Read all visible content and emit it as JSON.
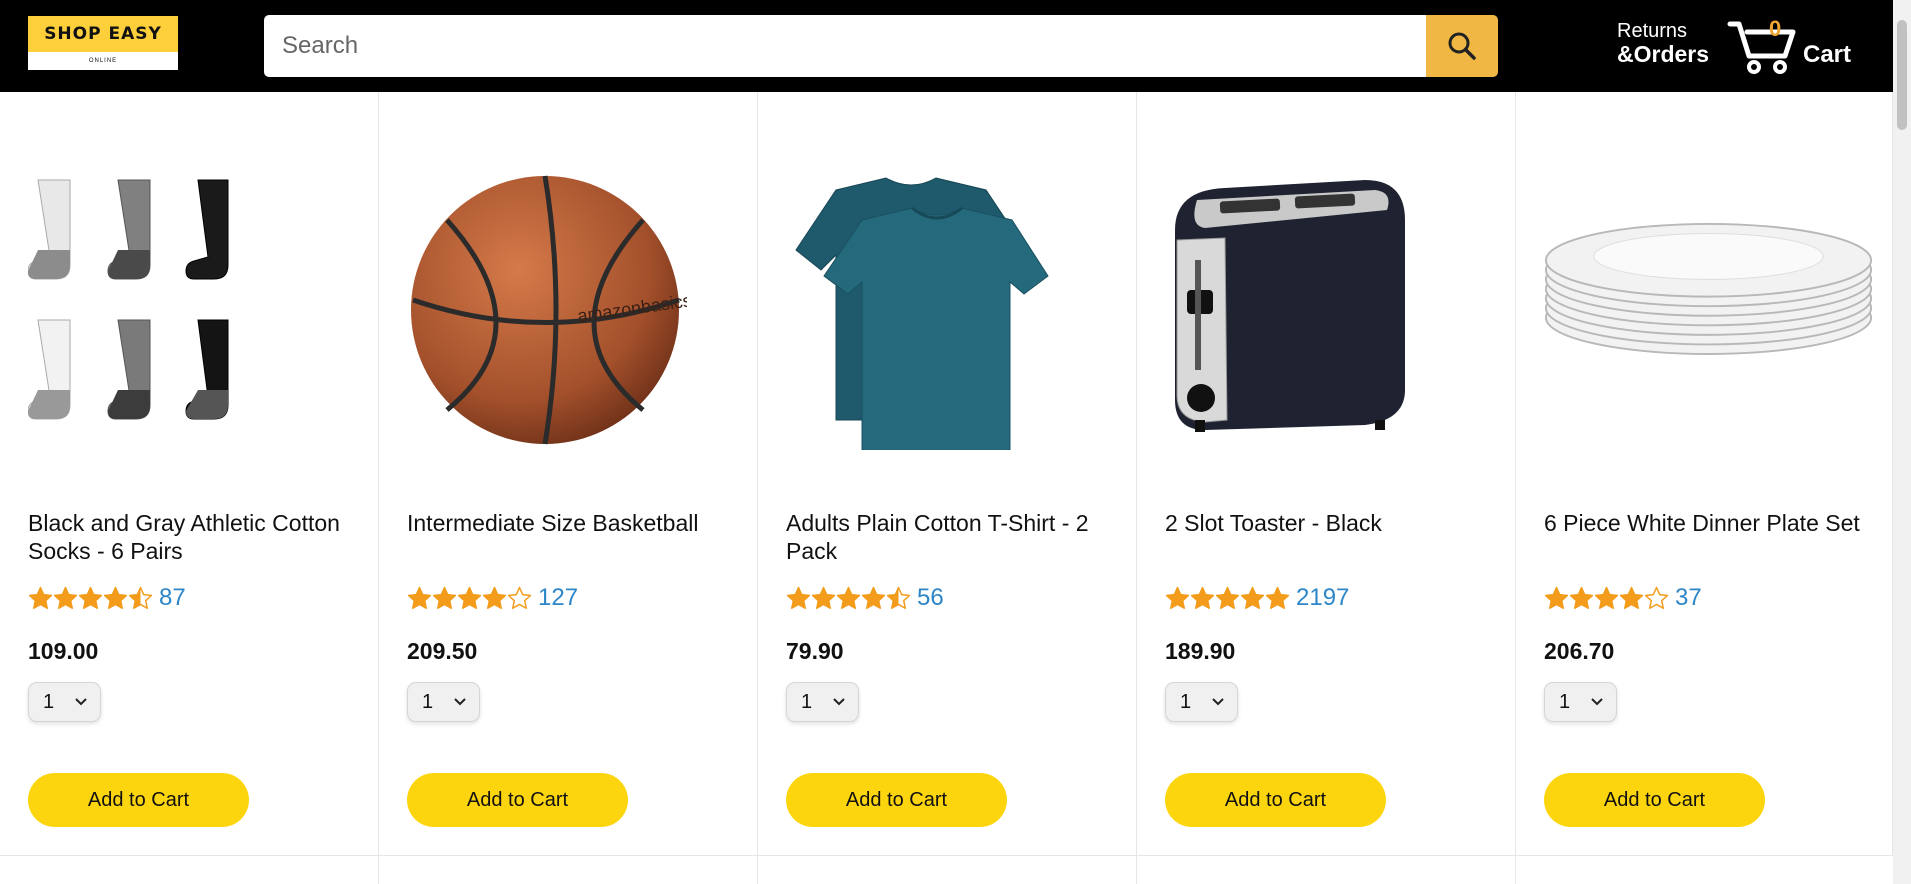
{
  "header": {
    "logo": {
      "title": "SHOP EASY",
      "subtitle": "ONLINE"
    },
    "search": {
      "placeholder": "Search"
    },
    "returns": {
      "line1": "Returns",
      "line2": "&Orders"
    },
    "cart": {
      "count": "0",
      "label": "Cart"
    },
    "colors": {
      "background": "#000000",
      "search_button": "#f0b744",
      "cart_count": "#f0a530"
    }
  },
  "products": [
    {
      "name": "Black and Gray Athletic Cotton Socks - 6 Pairs",
      "rating": 4.5,
      "rating_count": "87",
      "price": "109.00",
      "quantity": "1",
      "button": "Add to Cart",
      "image": "socks"
    },
    {
      "name": "Intermediate Size Basketball",
      "rating": 4.0,
      "rating_count": "127",
      "price": "209.50",
      "quantity": "1",
      "button": "Add to Cart",
      "image": "basketball"
    },
    {
      "name": "Adults Plain Cotton T-Shirt - 2 Pack",
      "rating": 4.5,
      "rating_count": "56",
      "price": "79.90",
      "quantity": "1",
      "button": "Add to Cart",
      "image": "tshirt"
    },
    {
      "name": "2 Slot Toaster - Black",
      "rating": 5.0,
      "rating_count": "2197",
      "price": "189.90",
      "quantity": "1",
      "button": "Add to Cart",
      "image": "toaster"
    },
    {
      "name": "6 Piece White Dinner Plate Set",
      "rating": 4.0,
      "rating_count": "37",
      "price": "206.70",
      "quantity": "1",
      "button": "Add to Cart",
      "image": "plates"
    }
  ],
  "colors": {
    "star": "#f39c1b",
    "rating_count": "#2d86c8",
    "add_button": "#fdd50e"
  }
}
